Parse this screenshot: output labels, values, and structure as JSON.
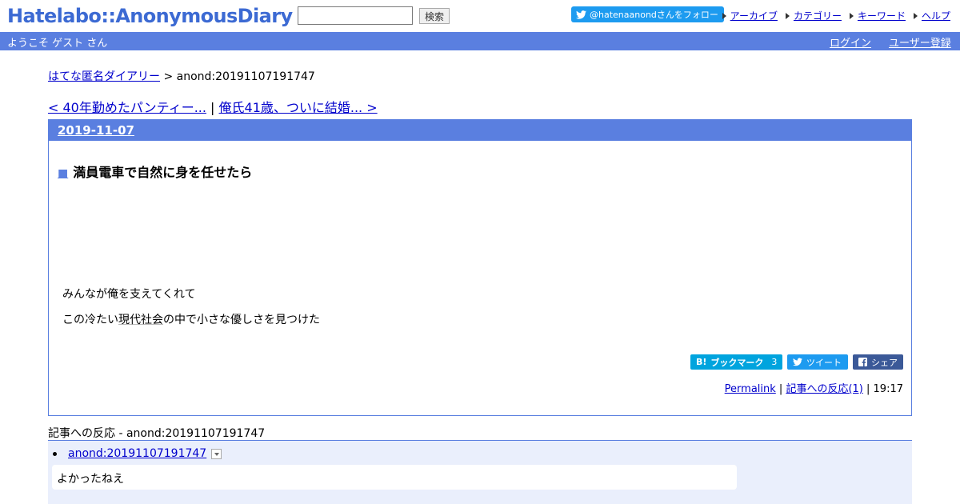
{
  "header": {
    "logo": "Hatelabo::AnonymousDiary",
    "search_placeholder": "",
    "search_button": "検索",
    "follow_label": "@hatenaanondさんをフォロー",
    "links": [
      "アーカイブ",
      "カテゴリー",
      "キーワード",
      "ヘルプ"
    ]
  },
  "bar": {
    "welcome": "ようこそ ゲスト さん",
    "login": "ログイン",
    "register": "ユーザー登録"
  },
  "breadcrumb": {
    "home": "はてな匿名ダイアリー",
    "sep": " > ",
    "current": "anond:20191107191747"
  },
  "pager": {
    "prev": "< 40年勤めたパンティー...",
    "sep": " | ",
    "next": "俺氏41歳、ついに結婚... >"
  },
  "day": {
    "date": "2019-11-07",
    "entry": {
      "marker": "■",
      "title": "満員電車で自然に身を任せたら",
      "line1": "みんなが俺を支えてくれて",
      "line2_pre": "この冷たい",
      "line2_kw": "現代社会",
      "line2_post": "の中で小さな優しさを見つけた",
      "share": {
        "hatena_mark": "B!",
        "hatena_label": "ブックマーク",
        "hatena_count": "3",
        "tweet": "ツイート",
        "fb": "シェア"
      },
      "footer": {
        "permalink": "Permalink",
        "sep": " | ",
        "reactions": "記事への反応(1)",
        "time": "19:17"
      }
    }
  },
  "reactions": {
    "title": "記事への反応 - anond:20191107191747",
    "items": [
      {
        "link": "anond:20191107191747",
        "body": "よかったねえ"
      }
    ]
  },
  "colors": {
    "accent": "#5a7fe0",
    "logo": "#3c6ad3",
    "twitter": "#1d9bf0",
    "hatena": "#00a4de",
    "facebook": "#3b5998",
    "reaction_bg": "#eaeffc"
  }
}
